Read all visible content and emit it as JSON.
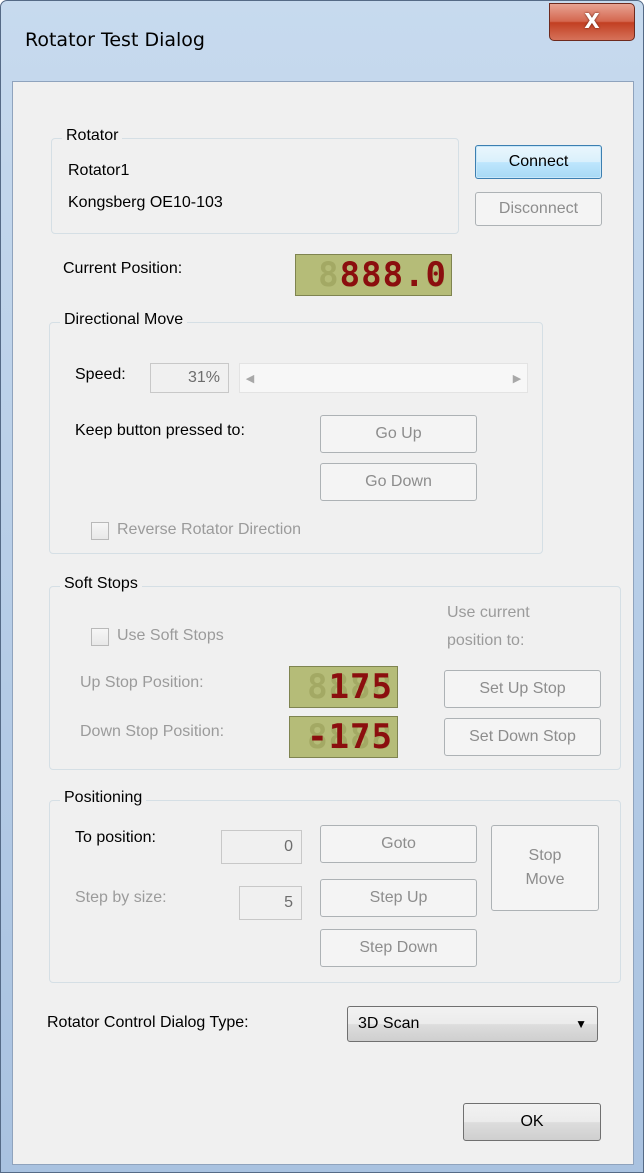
{
  "window": {
    "title": "Rotator Test Dialog",
    "close_glyph": "X"
  },
  "rotator": {
    "legend": "Rotator",
    "name": "Rotator1",
    "model": "Kongsberg OE10-103",
    "connect_label": "Connect",
    "disconnect_label": "Disconnect"
  },
  "current_position": {
    "label": "Current Position:",
    "ghost": "8888.8",
    "value": "888.0"
  },
  "directional_move": {
    "legend": "Directional Move",
    "speed_label": "Speed:",
    "speed_value": "31%",
    "keep_pressed_label": "Keep button pressed to:",
    "go_up_label": "Go Up",
    "go_down_label": "Go Down",
    "reverse_label": "Reverse Rotator Direction"
  },
  "soft_stops": {
    "legend": "Soft Stops",
    "use_label": "Use Soft Stops",
    "hint_line1": "Use current",
    "hint_line2": "position to:",
    "up_label": "Up Stop Position:",
    "up_ghost": "8888",
    "up_value": "175",
    "down_label": "Down Stop Position:",
    "down_ghost": "8888",
    "down_value": "-175",
    "set_up_label": "Set Up Stop",
    "set_down_label": "Set Down Stop"
  },
  "positioning": {
    "legend": "Positioning",
    "to_position_label": "To position:",
    "to_position_value": "0",
    "step_label": "Step by size:",
    "step_value": "5",
    "goto_label": "Goto",
    "step_up_label": "Step Up",
    "step_down_label": "Step Down",
    "stop_line1": "Stop",
    "stop_line2": "Move"
  },
  "dialog_type": {
    "label": "Rotator Control Dialog Type:",
    "selected": "3D Scan"
  },
  "ok_label": "OK",
  "colors": {
    "lcd_bg": "#b5bc78",
    "lcd_digit": "#8b0e0e",
    "close_red": "#c23f22",
    "default_button_blue": "#3c7fb1"
  }
}
